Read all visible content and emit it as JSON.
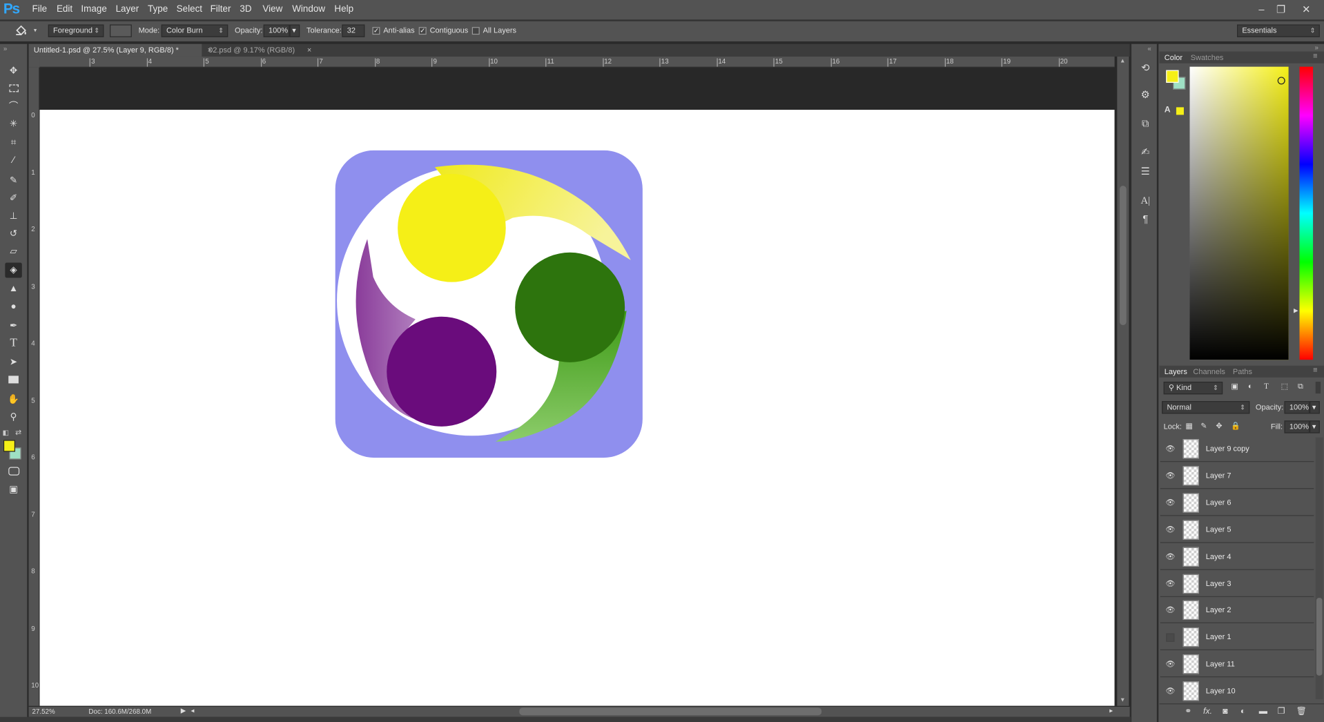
{
  "app": {
    "logo": "Ps"
  },
  "menu": [
    "File",
    "Edit",
    "Image",
    "Layer",
    "Type",
    "Select",
    "Filter",
    "3D",
    "View",
    "Window",
    "Help"
  ],
  "window_controls": [
    "–",
    "❐",
    "✕"
  ],
  "options": {
    "fill_source": "Foreground",
    "mode_label": "Mode:",
    "mode_value": "Color Burn",
    "opacity_label": "Opacity:",
    "opacity_value": "100%",
    "tolerance_label": "Tolerance:",
    "tolerance_value": "32",
    "antialias_label": "Anti-alias",
    "antialias_checked": true,
    "contiguous_label": "Contiguous",
    "contiguous_checked": true,
    "all_layers_label": "All Layers",
    "all_layers_checked": false,
    "workspace": "Essentials"
  },
  "tabs": [
    {
      "label": "Untitled-1.psd @ 27.5% (Layer 9, RGB/8) *",
      "active": true
    },
    {
      "label": "02.psd @ 9.17% (RGB/8)",
      "active": false
    }
  ],
  "ruler_h": [
    "3",
    "4",
    "5",
    "6",
    "7",
    "8",
    "9",
    "10",
    "11",
    "12",
    "13",
    "14",
    "15",
    "16",
    "17",
    "18",
    "19",
    "20"
  ],
  "ruler_v": [
    "0",
    "1",
    "2",
    "3",
    "4",
    "5",
    "6",
    "7",
    "8",
    "9",
    "10"
  ],
  "status": {
    "zoom": "27.52%",
    "doc": "Doc: 160.6M/268.0M"
  },
  "color_panel": {
    "tabs": [
      "Color",
      "Swatches"
    ],
    "foreground": "#f5ef17",
    "background": "#9ee0c4"
  },
  "layers_panel": {
    "tabs": [
      "Layers",
      "Channels",
      "Paths"
    ],
    "filter_kind": "Kind",
    "blend_mode": "Normal",
    "opacity_label": "Opacity:",
    "opacity_value": "100%",
    "lock_label": "Lock:",
    "fill_label": "Fill:",
    "fill_value": "100%",
    "layers": [
      {
        "name": "Layer 9 copy",
        "visible": true
      },
      {
        "name": "Layer 7",
        "visible": true
      },
      {
        "name": "Layer 6",
        "visible": true
      },
      {
        "name": "Layer 5",
        "visible": true
      },
      {
        "name": "Layer 4",
        "visible": true
      },
      {
        "name": "Layer 3",
        "visible": true
      },
      {
        "name": "Layer 2",
        "visible": true
      },
      {
        "name": "Layer 1",
        "visible": false
      },
      {
        "name": "Layer 11",
        "visible": true
      },
      {
        "name": "Layer 10",
        "visible": true
      }
    ]
  },
  "artwork": {
    "background": "#8f8fee",
    "yellow": "#f5ef17",
    "green": "#2d740d",
    "purple": "#6a0c7c"
  }
}
